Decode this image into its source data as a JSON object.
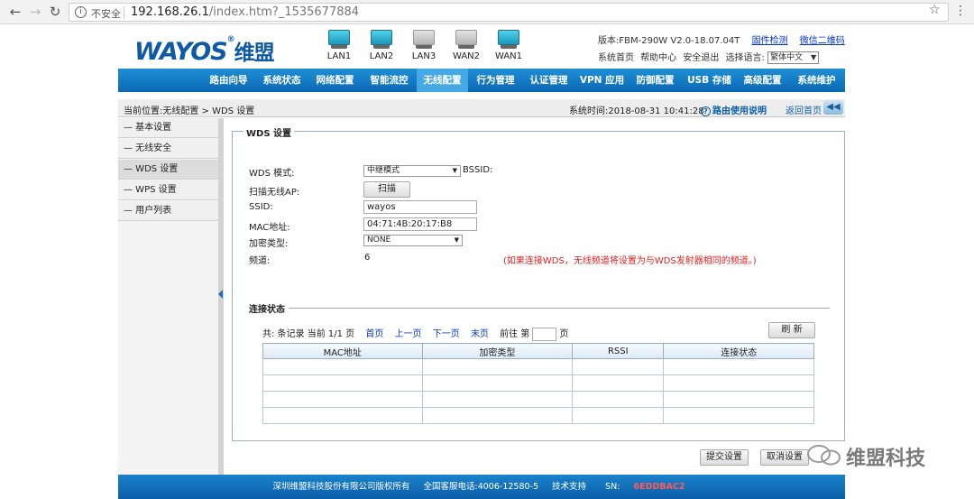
{
  "browser": {
    "security_label": "不安全",
    "url_host": "192.168.26.1",
    "url_path": "/index.htm?_1535677884"
  },
  "header": {
    "logo_text": "WAYOS",
    "logo_reg": "®",
    "logo_cn": "维盟",
    "ports": [
      {
        "label": "LAN1",
        "state": "on"
      },
      {
        "label": "LAN2",
        "state": "on"
      },
      {
        "label": "LAN3",
        "state": "off"
      },
      {
        "label": "WAN2",
        "state": "off"
      },
      {
        "label": "WAN1",
        "state": "on"
      }
    ],
    "version": "版本:FBM-290W V2.0-18.07.04T",
    "firmware_check": "固件检测",
    "wechat_qr": "微信二维码",
    "sys_home": "系统首页",
    "help_center": "帮助中心",
    "safe_exit": "安全退出",
    "lang_label": "选择语言:",
    "lang_value": "繁体中文"
  },
  "nav": [
    {
      "label": "路由向导",
      "active": false
    },
    {
      "label": "系统状态",
      "active": false
    },
    {
      "label": "网络配置",
      "active": false
    },
    {
      "label": "智能流控",
      "active": false
    },
    {
      "label": "无线配置",
      "active": true
    },
    {
      "label": "行为管理",
      "active": false
    },
    {
      "label": "认证管理",
      "active": false
    },
    {
      "label": "VPN 应用",
      "active": false
    },
    {
      "label": "防御配置",
      "active": false
    },
    {
      "label": "USB 存储",
      "active": false
    },
    {
      "label": "高级配置",
      "active": false
    },
    {
      "label": "系统维护",
      "active": false
    }
  ],
  "crumb": {
    "location": "当前位置:无线配置 > WDS 设置",
    "time": "系统时间:2018-08-31 10:41:28",
    "help": "路由使用说明",
    "home": "返回首页"
  },
  "sidebar": [
    {
      "label": "— 基本设置",
      "active": false
    },
    {
      "label": "— 无线安全",
      "active": false
    },
    {
      "label": "— WDS 设置",
      "active": true
    },
    {
      "label": "— WPS 设置",
      "active": false
    },
    {
      "label": "— 用户列表",
      "active": false
    }
  ],
  "wds": {
    "legend": "WDS 设置",
    "mode_label": "WDS 模式:",
    "mode_value": "中继模式",
    "bssid_label": "BSSID:",
    "scan_label": "扫描无线AP:",
    "scan_button": "扫描",
    "ssid_label": "SSID:",
    "ssid_value": "wayos",
    "mac_label": "MAC地址:",
    "mac_value": "04:71:4B:20:17:B8",
    "enc_label": "加密类型:",
    "enc_value": "NONE",
    "channel_label": "频道:",
    "channel_value": "6",
    "note": "(如果连接WDS，无线频道将设置为与WDS发射器相同的频道。)"
  },
  "conn": {
    "title": "连接状态",
    "pager_prefix": "共: 条记录 当前 1/1 页",
    "first": "首页",
    "prev": "上一页",
    "next": "下一页",
    "last": "末页",
    "goto_prefix": "前往 第",
    "goto_suffix": "页",
    "refresh": "刷 新",
    "columns": [
      "MAC地址",
      "加密类型",
      "RSSI",
      "连接状态"
    ]
  },
  "actions": {
    "submit": "提交设置",
    "cancel": "取消设置"
  },
  "footer": {
    "company": "深圳维盟科技股份有限公司版权所有",
    "hotline": "全国客服电话:4006-12580-5",
    "support": "技术支持",
    "sn_label": "SN:",
    "sn_value": "6EDDBAC2"
  },
  "watermark": {
    "text": "维盟科技"
  }
}
